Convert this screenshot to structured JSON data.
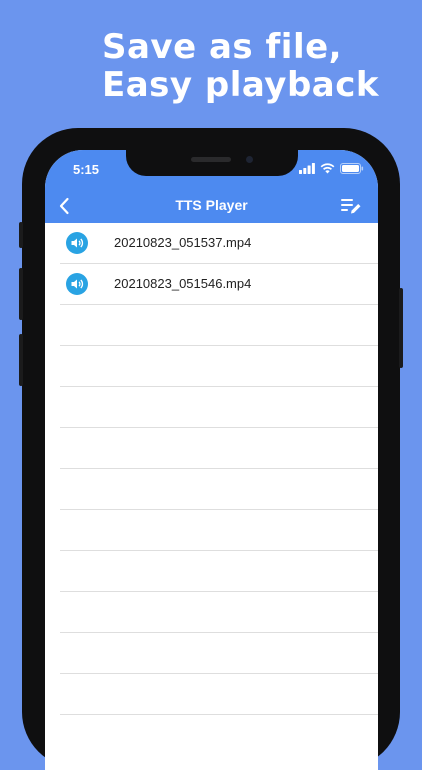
{
  "headline": {
    "line1": "Save as file,",
    "line2": "Easy playback"
  },
  "status_bar": {
    "time": "5:15",
    "icons": [
      "signal-icon",
      "wifi-icon",
      "battery-icon"
    ]
  },
  "nav": {
    "title": "TTS Player",
    "back_icon": "chevron-left-icon",
    "edit_icon": "list-edit-icon"
  },
  "files": [
    {
      "name": "20210823_051537.mp4",
      "icon": "speaker-icon"
    },
    {
      "name": "20210823_051546.mp4",
      "icon": "speaker-icon"
    }
  ],
  "colors": {
    "background": "#6b95ee",
    "nav_bar": "#4d8af0",
    "speaker_icon": "#29a3e3"
  }
}
